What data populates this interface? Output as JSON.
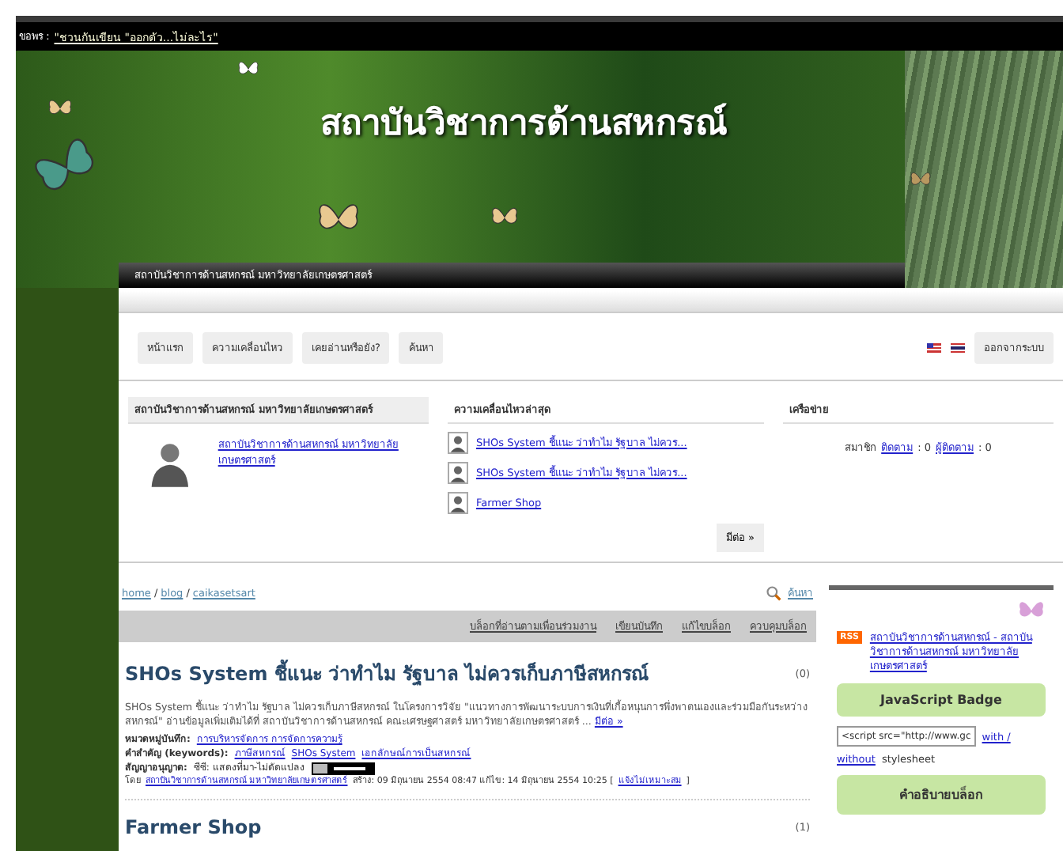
{
  "top_bar": {
    "label": "ขอพร :",
    "link": "\"ชวนกันเขียน \"ออกตัว...ไม่ละไร\""
  },
  "banner": {
    "title": "สถาบันวิชาการด้านสหกรณ์",
    "subtitle": "สถาบันวิชาการด้านสหกรณ์ มหาวิทยาลัยเกษตรศาสตร์"
  },
  "nav": {
    "tabs": [
      {
        "label": "หน้าแรก",
        "selected": false
      },
      {
        "label": "ความเคลื่อนไหว",
        "selected": false
      },
      {
        "label": "เคยอ่านหรือยัง?",
        "selected": false
      },
      {
        "label": "ค้นหา",
        "selected": false
      }
    ],
    "logout": "ออกจากระบบ"
  },
  "profile": {
    "heading": "สถาบันวิชาการด้านสหกรณ์ มหาวิทยาลัยเกษตรศาสตร์",
    "link": "สถาบันวิชาการด้านสหกรณ์ มหาวิทยาลัยเกษตรศาสตร์"
  },
  "latest": {
    "heading": "ความเคลื่อนไหวล่าสุด",
    "items": [
      "SHOs System ชี้แนะ ว่าทำไม รัฐบาล ไม่ควร...",
      "SHOs System ชี้แนะ ว่าทำไม รัฐบาล ไม่ควร...",
      "Farmer Shop"
    ],
    "more": "มีต่อ »"
  },
  "network": {
    "heading": "เครือข่าย",
    "members": "สมาชิก",
    "following_label": "ติดตาม",
    "following": ": 0",
    "followers_label": "ผู้ติดตาม",
    "followers": ": 0"
  },
  "breadcrumb": {
    "links": [
      "home",
      "blog",
      "caikasetsart"
    ],
    "separator": "/"
  },
  "search": "ค้นหา",
  "blog_menu": [
    "บล็อกที่อ่านตามเพื่อนร่วมงาน",
    "เขียนบันทึก",
    "แก้ไขบล็อก",
    "ควบคุมบล็อก"
  ],
  "posts": [
    {
      "title": "SHOs System ชี้แนะ ว่าทำไม รัฐบาล ไม่ควรเก็บภาษีสหกรณ์",
      "comments": "(0)",
      "body": "SHOs System ชี้แนะ ว่าทำไม รัฐบาล ไม่ควรเก็บภาษีสหกรณ์ ในโครงการวิจัย \"แนวทางการพัฒนาระบบการเงินที่เกื้อหนุนการพึ่งพาตนเองและร่วมมือกันระหว่างสหกรณ์\" อ่านข้อมูลเพิ่มเติมได้ที่ สถาบันวิชาการด้านสหกรณ์ คณะเศรษฐศาสตร์ มหาวิทยาลัยเกษตรศาสตร์ ...",
      "more": "มีต่อ »",
      "category_label": "หมวดหมู่บันทึก:",
      "category": "การบริหารจัดการ การจัดการความรู้",
      "keywords_label": "คำสำคัญ (keywords):",
      "keywords": [
        "ภาษีสหกรณ์",
        "SHOs System",
        "เอกลักษณ์การเป็นสหกรณ์"
      ],
      "license_label": "สัญญาอนุญาต:",
      "license": "ซีซี: แสดงที่มา-ไม่ดัดแปลง",
      "by": "โดย",
      "author": "สถาบันวิชาการด้านสหกรณ์ มหาวิทยาลัยเกษตรศาสตร์",
      "dates": "สร้าง: 09 มิถุนายน 2554 08:47 แก้ไข: 14 มิถุนายน 2554 10:25 [",
      "report": "แจ้งไม่เหมาะสม",
      "end": "]"
    },
    {
      "title": "Farmer Shop",
      "comments": "(1)"
    }
  ],
  "sidebar": {
    "rss": "RSS",
    "feed_link": "สถาบันวิชาการด้านสหกรณ์ - สถาบันวิชาการด้านสหกรณ์ มหาวิทยาลัยเกษตรศาสตร์",
    "badge_heading": "JavaScript Badge",
    "badge_code": "<script src=\"http://www.gc",
    "with": "with /",
    "without": "without",
    "stylesheet": "stylesheet",
    "description_heading": "คำอธิบายบล็อก"
  }
}
